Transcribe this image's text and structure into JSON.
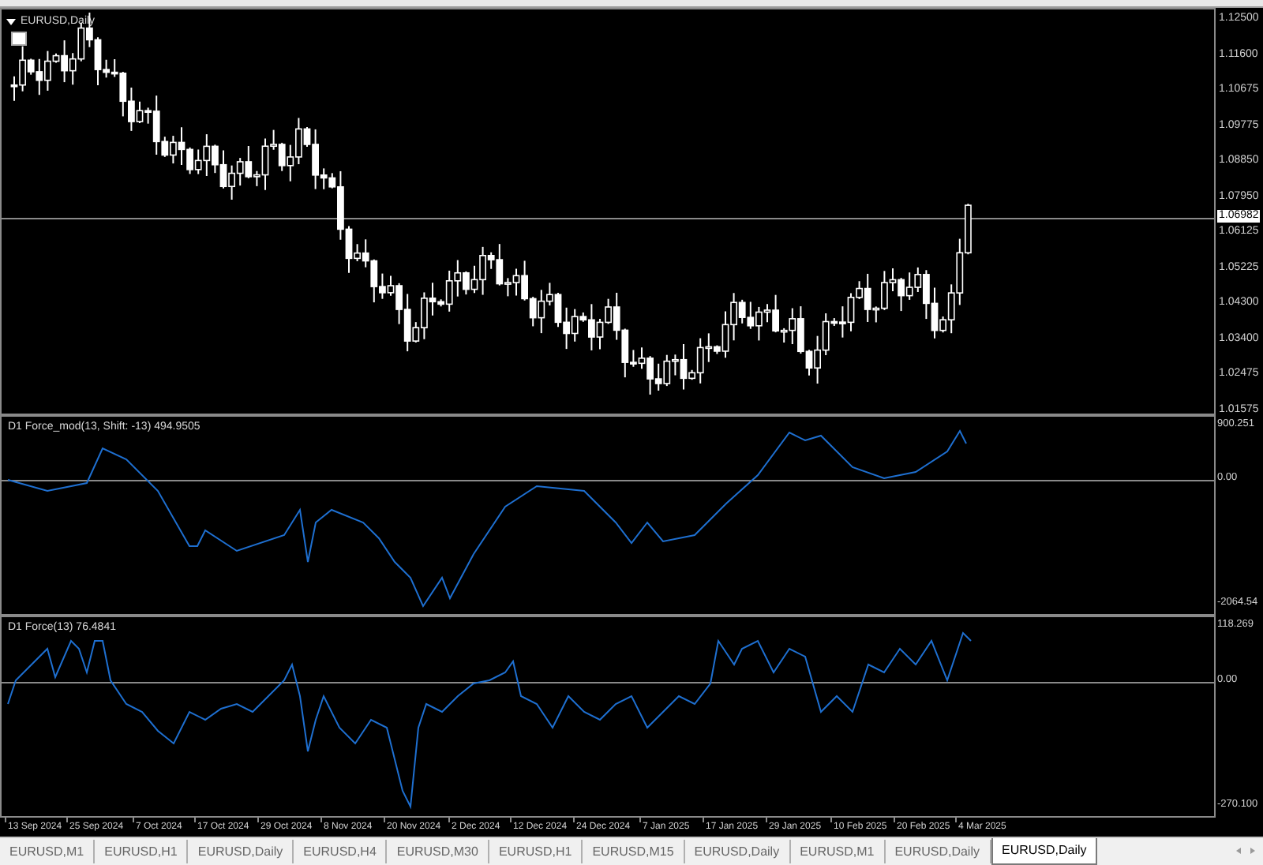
{
  "chart_window": {
    "title": "EURUSD,Daily",
    "price_axis": [
      "1.12500",
      "1.11600",
      "1.10675",
      "1.09775",
      "1.08850",
      "1.07950",
      "1.06125",
      "1.05225",
      "1.04300",
      "1.03400",
      "1.02475",
      "1.01575"
    ],
    "current_price": "1.06982"
  },
  "indicators": [
    {
      "label": "D1 Force_mod(13, Shift: -13) 494.9505",
      "axis": [
        "900.251",
        "0.00",
        "-2064.54"
      ]
    },
    {
      "label": "D1 Force(13) 76.4841",
      "axis": [
        "118.269",
        "0.00",
        "-270.100"
      ]
    }
  ],
  "time_axis": [
    "13 Sep 2024",
    "25 Sep 2024",
    "7 Oct 2024",
    "17 Oct 2024",
    "29 Oct 2024",
    "8 Nov 2024",
    "20 Nov 2024",
    "2 Dec 2024",
    "12 Dec 2024",
    "24 Dec 2024",
    "7 Jan 2025",
    "17 Jan 2025",
    "29 Jan 2025",
    "10 Feb 2025",
    "20 Feb 2025",
    "4 Mar 2025"
  ],
  "tabs": [
    {
      "label": "EURUSD,M1",
      "selected": false
    },
    {
      "label": "EURUSD,H1",
      "selected": false
    },
    {
      "label": "EURUSD,Daily",
      "selected": false
    },
    {
      "label": "EURUSD,H4",
      "selected": false
    },
    {
      "label": "EURUSD,M30",
      "selected": false
    },
    {
      "label": "EURUSD,H1",
      "selected": false
    },
    {
      "label": "EURUSD,M15",
      "selected": false
    },
    {
      "label": "EURUSD,Daily",
      "selected": false
    },
    {
      "label": "EURUSD,M1",
      "selected": false
    },
    {
      "label": "EURUSD,Daily",
      "selected": false
    },
    {
      "label": "EURUSD,Daily",
      "selected": true
    }
  ]
}
